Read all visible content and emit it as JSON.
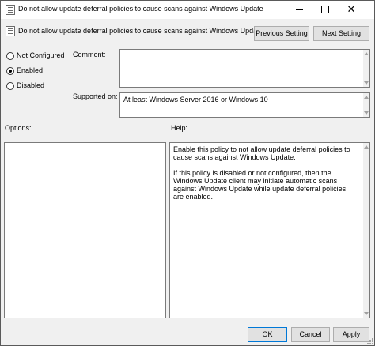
{
  "window": {
    "title": "Do not allow update deferral policies to cause scans against Windows Update",
    "icon": "policy-icon",
    "close_glyph": "✕"
  },
  "header": {
    "policy_name": "Do not allow update deferral policies to cause scans against Windows Update",
    "prev_label": "Previous Setting",
    "next_label": "Next Setting"
  },
  "state": {
    "options": [
      {
        "label": "Not Configured",
        "selected": false
      },
      {
        "label": "Enabled",
        "selected": true
      },
      {
        "label": "Disabled",
        "selected": false
      }
    ]
  },
  "comment": {
    "label": "Comment:",
    "value": ""
  },
  "supported": {
    "label": "Supported on:",
    "value": "At least Windows Server 2016 or Windows 10"
  },
  "options_panel": {
    "label": "Options:"
  },
  "help_panel": {
    "label": "Help:",
    "paragraphs": [
      "Enable this policy to not allow update deferral policies to cause scans against Windows Update.",
      "If this policy is disabled or not configured, then the Windows Update client may initiate automatic scans against Windows Update while update deferral policies are enabled."
    ]
  },
  "footer": {
    "ok_label": "OK",
    "cancel_label": "Cancel",
    "apply_label": "Apply"
  }
}
